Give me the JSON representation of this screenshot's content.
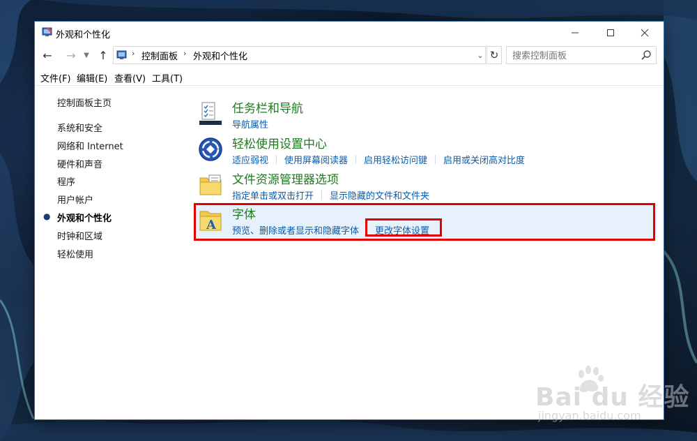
{
  "window": {
    "title": "外观和个性化"
  },
  "navigation": {
    "address_segments": [
      "控制面板",
      "外观和个性化"
    ],
    "search_placeholder": "搜索控制面板"
  },
  "menu": [
    "文件(F)",
    "编辑(E)",
    "查看(V)",
    "工具(T)"
  ],
  "sidebar": {
    "home": "控制面板主页",
    "items": [
      "系统和安全",
      "网络和 Internet",
      "硬件和声音",
      "程序",
      "用户帐户",
      "外观和个性化",
      "时钟和区域",
      "轻松使用"
    ],
    "active_index": 5
  },
  "categories": [
    {
      "title": "任务栏和导航",
      "links": [
        "导航属性"
      ],
      "icon": "taskbar-icon"
    },
    {
      "title": "轻松使用设置中心",
      "links": [
        "适应弱视",
        "使用屏幕阅读器",
        "启用轻松访问键",
        "启用或关闭高对比度"
      ],
      "icon": "ease-of-access-icon"
    },
    {
      "title": "文件资源管理器选项",
      "links": [
        "指定单击或双击打开",
        "显示隐藏的文件和文件夹"
      ],
      "icon": "folder-options-icon"
    },
    {
      "title": "字体",
      "links": [
        "预览、删除或者显示和隐藏字体",
        "更改字体设置"
      ],
      "icon": "fonts-icon",
      "highlighted": true
    }
  ],
  "watermark": {
    "brand": "Bai du 经验",
    "url": "jingyan.baidu.com"
  },
  "colors": {
    "category_title": "#1f7a1f",
    "link": "#0b5cad",
    "highlight": "#e00000",
    "hover_bg": "#e6f1fb"
  }
}
